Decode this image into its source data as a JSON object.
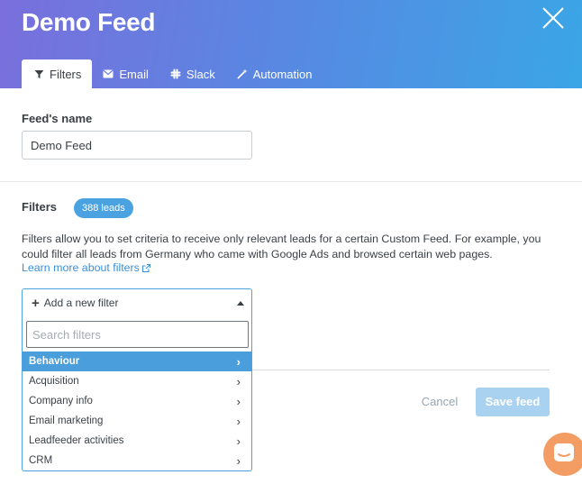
{
  "header": {
    "title": "Demo Feed",
    "tabs": [
      {
        "label": "Filters",
        "icon": "filter-icon",
        "active": true
      },
      {
        "label": "Email",
        "icon": "envelope-icon",
        "active": false
      },
      {
        "label": "Slack",
        "icon": "slack-icon",
        "active": false
      },
      {
        "label": "Automation",
        "icon": "wand-icon",
        "active": false
      }
    ]
  },
  "feed_name": {
    "label": "Feed's name",
    "value": "Demo Feed"
  },
  "filters": {
    "label": "Filters",
    "badge": "388 leads",
    "description": "Filters allow you to set criteria to receive only relevant leads for a certain Custom Feed. For example, you could filter all leads from Germany who came with Google Ads and browsed certain web pages.",
    "learn_more": "Learn more about filters",
    "add_filter_label": "Add a new filter",
    "search_placeholder": "Search filters",
    "categories": [
      {
        "label": "Behaviour",
        "highlighted": true
      },
      {
        "label": "Acquisition",
        "highlighted": false
      },
      {
        "label": "Company info",
        "highlighted": false
      },
      {
        "label": "Email marketing",
        "highlighted": false
      },
      {
        "label": "Leadfeeder activities",
        "highlighted": false
      },
      {
        "label": "CRM",
        "highlighted": false
      }
    ]
  },
  "actions": {
    "cancel": "Cancel",
    "save": "Save feed"
  },
  "colors": {
    "accent": "#4aa3e0",
    "save_disabled": "#a9d2f0",
    "chat": "#f39c63"
  }
}
